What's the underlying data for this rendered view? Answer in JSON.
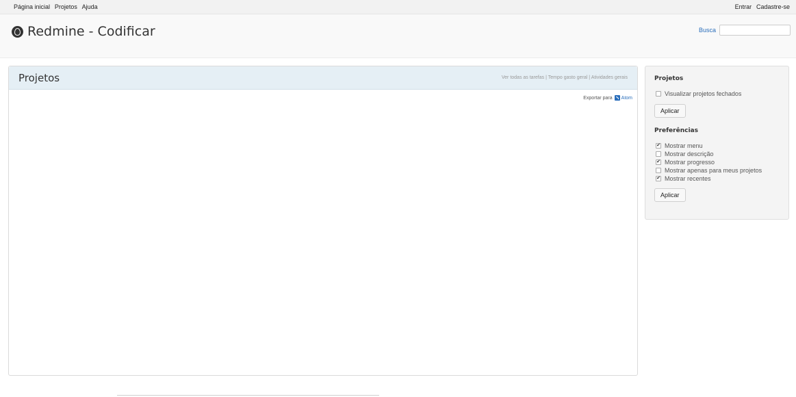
{
  "top_menu": {
    "left": [
      "Página inicial",
      "Projetos",
      "Ajuda"
    ],
    "right": [
      "Entrar",
      "Cadastre-se"
    ]
  },
  "header": {
    "title": "Redmine - Codificar",
    "search_label": "Busca",
    "search_value": ""
  },
  "main": {
    "title": "Projetos",
    "links": [
      "Ver todas as tarefas",
      "Tempo gasto geral",
      "Atividades gerais"
    ],
    "separator": "|",
    "export_label": "Exportar para",
    "export_format": "Atom"
  },
  "sidebar": {
    "projects_heading": "Projetos",
    "closed_projects": {
      "label": "Visualizar projetos fechados",
      "checked": false
    },
    "apply_label": "Aplicar",
    "prefs_heading": "Preferências",
    "prefs": [
      {
        "label": "Mostrar menu",
        "checked": true
      },
      {
        "label": "Mostrar descrição",
        "checked": false
      },
      {
        "label": "Mostrar progresso",
        "checked": true
      },
      {
        "label": "Mostrar apenas para meus projetos",
        "checked": false
      },
      {
        "label": "Mostrar recentes",
        "checked": true
      }
    ],
    "prefs_apply_label": "Aplicar"
  },
  "colors": {
    "link": "#2a6ebb",
    "header_bg": "#e5eff5"
  }
}
